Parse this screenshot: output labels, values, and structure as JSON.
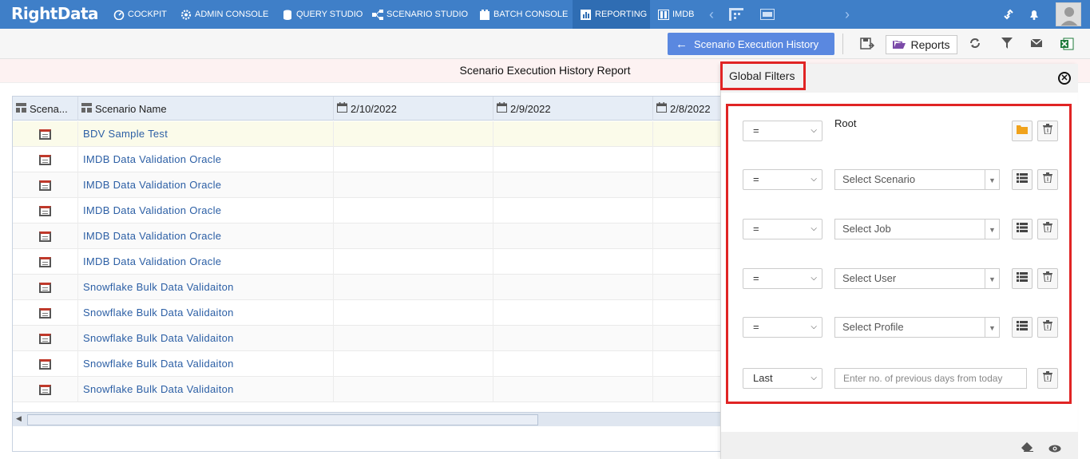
{
  "app": {
    "logo": "RightData"
  },
  "nav": {
    "items": [
      {
        "label": "COCKPIT",
        "icon": "cockpit-icon"
      },
      {
        "label": "ADMIN CONSOLE",
        "icon": "gear-icon"
      },
      {
        "label": "QUERY STUDIO",
        "icon": "database-icon"
      },
      {
        "label": "SCENARIO STUDIO",
        "icon": "sitemap-icon"
      },
      {
        "label": "BATCH CONSOLE",
        "icon": "batch-icon"
      },
      {
        "label": "REPORTING",
        "icon": "chart-icon",
        "active": true
      },
      {
        "label": "IMDB",
        "icon": "columns-icon"
      }
    ]
  },
  "toolbar": {
    "back_label": "Scenario Execution History",
    "reports_label": "Reports"
  },
  "report": {
    "title": "Scenario Execution History Report",
    "columns": [
      "Scena...",
      "Scenario Name",
      "2/10/2022",
      "2/9/2022",
      "2/8/2022"
    ],
    "rows": [
      "BDV Sample Test",
      "IMDB Data Validation Oracle",
      "IMDB Data Validation Oracle",
      "IMDB Data Validation Oracle",
      "IMDB Data Validation Oracle",
      "IMDB Data Validation Oracle",
      "Snowflake Bulk Data Validaiton",
      "Snowflake Bulk Data Validaiton",
      "Snowflake Bulk Data Validaiton",
      "Snowflake Bulk Data Validaiton",
      "Snowflake Bulk Data Validaiton"
    ]
  },
  "filters": {
    "title": "Global Filters",
    "rows": [
      {
        "op": "=",
        "kind": "root",
        "label": "Root"
      },
      {
        "op": "=",
        "kind": "select",
        "placeholder": "Select Scenario"
      },
      {
        "op": "=",
        "kind": "select",
        "placeholder": "Select Job"
      },
      {
        "op": "=",
        "kind": "select",
        "placeholder": "Select User"
      },
      {
        "op": "=",
        "kind": "select",
        "placeholder": "Select Profile"
      },
      {
        "op": "Last",
        "kind": "days",
        "placeholder": "Enter no. of previous days from today"
      }
    ]
  },
  "colors": {
    "nav": "#3f7fc8",
    "highlight": "#e02424",
    "link": "#2c5fa5",
    "back_button": "#5a88e0"
  }
}
